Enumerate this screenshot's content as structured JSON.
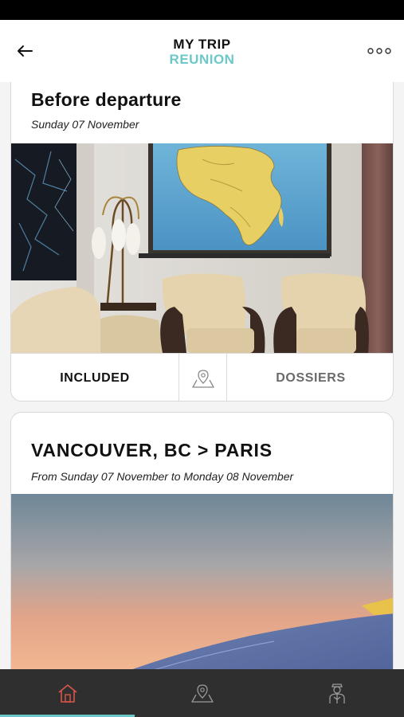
{
  "header": {
    "title": "MY TRIP",
    "subtitle": "REUNION",
    "back_icon": "arrow-left-icon",
    "more_icon": "more-dots-icon"
  },
  "cards": [
    {
      "title": "Before departure",
      "date": "Sunday 07 November",
      "image": "living-room-with-africa-map-photo",
      "actions": {
        "included": "INCLUDED",
        "map_icon": "map-pin-icon",
        "dossiers": "DOSSIERS"
      }
    },
    {
      "title": "VANCOUVER, BC > PARIS",
      "date": "From Sunday 07 November to Monday 08 November",
      "image": "airplane-wing-sunset-photo"
    }
  ],
  "bottom_nav": {
    "items": [
      "home-icon",
      "map-pin-icon",
      "concierge-icon"
    ],
    "active": "home-icon"
  },
  "colors": {
    "accent": "#6cc8c8",
    "active_nav": "#d9564a",
    "nav_bg": "#2f2f2f"
  }
}
